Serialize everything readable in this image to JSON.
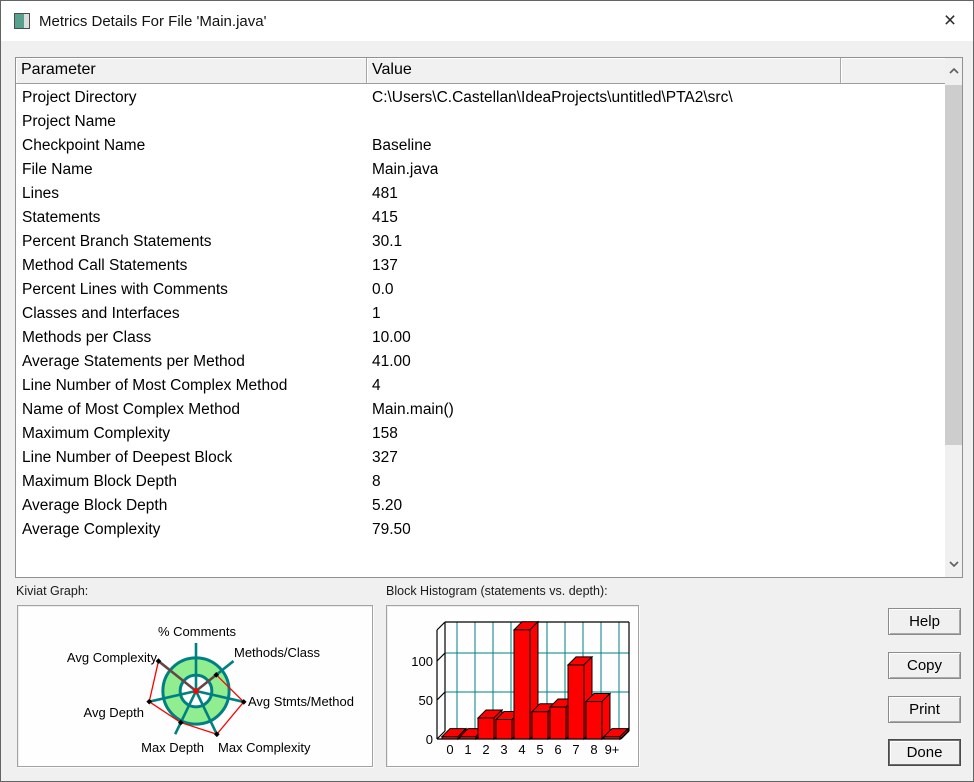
{
  "window": {
    "title": "Metrics Details For File 'Main.java'",
    "close_glyph": "×"
  },
  "table": {
    "columns": [
      "Parameter",
      "Value"
    ],
    "rows": [
      {
        "param": "Project Directory",
        "value": "C:\\Users\\C.Castellan\\IdeaProjects\\untitled\\PTA2\\src\\"
      },
      {
        "param": "Project Name",
        "value": ""
      },
      {
        "param": "Checkpoint Name",
        "value": "Baseline"
      },
      {
        "param": "File Name",
        "value": "Main.java"
      },
      {
        "param": "Lines",
        "value": "481"
      },
      {
        "param": "Statements",
        "value": "415"
      },
      {
        "param": "Percent Branch Statements",
        "value": "30.1"
      },
      {
        "param": "Method Call Statements",
        "value": "137"
      },
      {
        "param": "Percent Lines with Comments",
        "value": "0.0"
      },
      {
        "param": "Classes and Interfaces",
        "value": "1"
      },
      {
        "param": "Methods per Class",
        "value": "10.00"
      },
      {
        "param": "Average Statements per Method",
        "value": "41.00"
      },
      {
        "param": "Line Number of Most Complex Method",
        "value": "4"
      },
      {
        "param": "Name of Most Complex Method",
        "value": "Main.main()"
      },
      {
        "param": "Maximum Complexity",
        "value": "158"
      },
      {
        "param": "Line Number of Deepest Block",
        "value": "327"
      },
      {
        "param": "Maximum Block Depth",
        "value": "8"
      },
      {
        "param": "Average Block Depth",
        "value": "5.20"
      },
      {
        "param": "Average Complexity",
        "value": "79.50"
      }
    ]
  },
  "kiviat": {
    "caption": "Kiviat Graph:",
    "chart_data": {
      "type": "radar",
      "axes": [
        "% Comments",
        "Methods/Class",
        "Avg Stmts/Method",
        "Max Complexity",
        "Max Depth",
        "Avg Depth",
        "Avg Complexity"
      ],
      "values_fraction_of_axis": [
        0.0,
        0.54,
        1.02,
        1.0,
        0.73,
        1.0,
        1.0
      ],
      "rings": {
        "inner_radius_fraction": 0.33,
        "outer_radius_fraction": 0.69
      }
    }
  },
  "histogram": {
    "caption": "Block Histogram (statements vs. depth):",
    "chart_data": {
      "type": "bar",
      "categories": [
        "0",
        "1",
        "2",
        "3",
        "4",
        "5",
        "6",
        "7",
        "8",
        "9+"
      ],
      "values": [
        3,
        3,
        27,
        25,
        140,
        35,
        41,
        95,
        48,
        3
      ],
      "yticks": [
        0,
        50,
        100
      ],
      "grid": true,
      "style": "3d"
    }
  },
  "buttons": [
    "Help",
    "Copy",
    "Print",
    "Done"
  ],
  "colors": {
    "teal": "#008080",
    "ring_green": "#90ee90",
    "bar_red": "#ff0000",
    "maroon_overlay": "#8b3434",
    "dialog_bg": "#f0f0f0"
  }
}
